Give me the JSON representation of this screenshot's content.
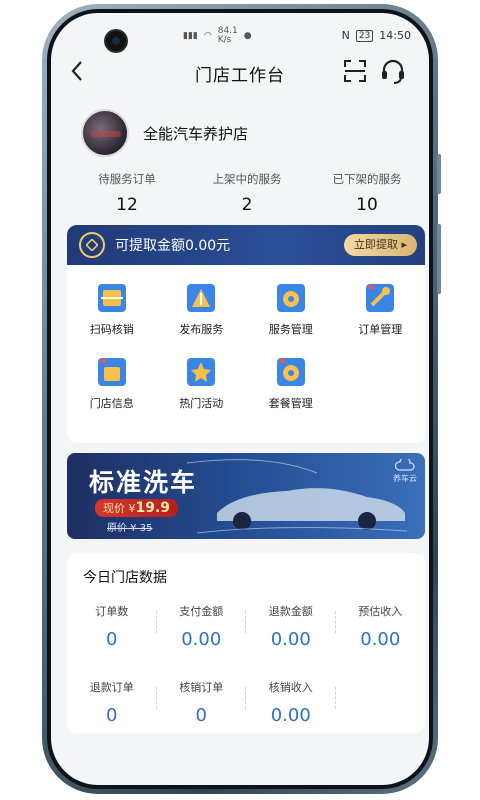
{
  "status_bar": {
    "net_speed": "84.1\nK/s",
    "battery": "23",
    "time": "14:50"
  },
  "nav": {
    "title": "门店工作台"
  },
  "store": {
    "name": "全能汽车养护店"
  },
  "stats": [
    {
      "label": "待服务订单",
      "value": "12"
    },
    {
      "label": "上架中的服务",
      "value": "2"
    },
    {
      "label": "已下架的服务",
      "value": "10"
    }
  ],
  "wallet": {
    "text": "可提取金额0.00元",
    "button": "立即提取"
  },
  "menu": [
    {
      "label": "扫码核销",
      "icon": "scan-verify-icon"
    },
    {
      "label": "发布服务",
      "icon": "publish-service-icon"
    },
    {
      "label": "服务管理",
      "icon": "service-manage-icon"
    },
    {
      "label": "订单管理",
      "icon": "order-manage-icon"
    },
    {
      "label": "门店信息",
      "icon": "store-info-icon"
    },
    {
      "label": "热门活动",
      "icon": "hot-activity-icon"
    },
    {
      "label": "套餐管理",
      "icon": "package-manage-icon"
    }
  ],
  "banner": {
    "title": "标准洗车",
    "price_prefix": "现价 ¥",
    "price_now": "19.9",
    "price_orig": "原价 ¥ 35",
    "brand": "养车云"
  },
  "today": {
    "title": "今日门店数据",
    "row1": [
      {
        "label": "订单数",
        "value": "0"
      },
      {
        "label": "支付金额",
        "value": "0.00"
      },
      {
        "label": "退款金额",
        "value": "0.00"
      },
      {
        "label": "预估收入",
        "value": "0.00"
      }
    ],
    "row2": [
      {
        "label": "退款订单",
        "value": "0"
      },
      {
        "label": "核销订单",
        "value": "0"
      },
      {
        "label": "核销收入",
        "value": "0.00"
      }
    ]
  },
  "colors": {
    "accent_blue": "#2f72c8",
    "wallet_bg": "#24407f",
    "gold": "#d9b675"
  }
}
